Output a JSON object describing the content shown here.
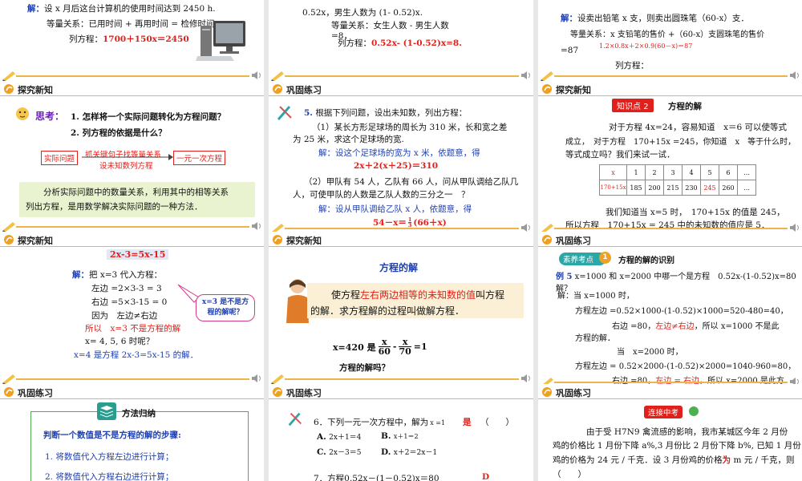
{
  "colors": {
    "header_accent": "#f0b24a",
    "title_red": "#e0201a",
    "answer_blue": "#1f3fae",
    "badge_red": "#e0201a",
    "badge_teal": "#2aa8a8",
    "panel_green": "#e9f3cf"
  },
  "icons": {
    "header": "orange-curl-icon",
    "footer_left": "pencil-icon",
    "footer_right": "speaker-icon",
    "computer": "desktop-computer-icon"
  },
  "s1": {
    "solve": "解：",
    "text1": "设 x 月后这台计算机的使用时间达到 2450 h.",
    "text2": "等量关系：已用时间 + 再用时间 = 检修时间,",
    "eq_label": "列方程：",
    "eq": "1700＋150x＝2450"
  },
  "s2": {
    "text1": "0.52x，男生人数为 (1- 0.52)x.",
    "text2": "等量关系：女生人数 - 男生人数",
    "text3": "=8，",
    "eq_label": "列方程：",
    "eq": "0.52x- (1-0.52)x=8."
  },
  "s3": {
    "solve": "解：",
    "text1": "设卖出铅笔 x 支，则卖出圆珠笔（60-x）支．",
    "text2": "等量关系：x 支铅笔的售价 +（60-x）支圆珠笔的售价",
    "text3": "=87",
    "eq": "1.2×0.8x＋2×0.9(60－x)＝87",
    "eq_label": "列方程："
  },
  "s4": {
    "title": "探究新知",
    "think": "思考：",
    "q1": "1. 怎样将一个实际问题转化为方程问题？",
    "q2": "2. 列方程的依据是什么？",
    "box1": "实际问题",
    "arrow_top": "抓关键句子找等量关系",
    "arrow_bottom": "设未知数列方程",
    "box2": "一元一次方程",
    "panel1": "分析实际问题中的数量关系，利用其中的相等关系",
    "panel2": "列出方程，是用数学解决实际问题的一种方法．"
  },
  "s5": {
    "title": "巩固练习",
    "num": "5.",
    "q": "根据下列问题，设出未知数，列出方程：",
    "p1a": "（1）某长方形足球场的周长为 310 米，长和宽之差",
    "p1b": "为 25 米，求这个足球场的宽.",
    "a1": "解：设这个足球场的宽为 x 米，依题意，得",
    "a1eq": "2x＋2(x＋25)＝310",
    "p2a": "（2）甲队有 54 人，乙队有 66 人，问从甲队调给乙队几",
    "p2b": "人，可使甲队的人数是乙队人数的三分之一　？",
    "a2": "解：设从甲队调给乙队 x 人，依题意，得",
    "a2eq_l": "54－x＝",
    "a2eq_num": "1",
    "a2eq_den": "3",
    "a2eq_r": "(66＋x)"
  },
  "s6": {
    "title": "探究新知",
    "badge_label": "知识点",
    "badge_num": "2",
    "badge_title": "方程的解",
    "t1": "对于方程 4x=24，容易知道　x＝6 可以使等式",
    "t2": "成立，　对于方程　170+15x =245，你知道　x　等于什么时，",
    "t3": "等式成立吗？我们来试一试．",
    "table_head": [
      "x",
      "1",
      "2",
      "3",
      "4",
      "5",
      "6",
      "…"
    ],
    "table_row": [
      "170+15x",
      "185",
      "200",
      "215",
      "230",
      "245",
      "260",
      "…"
    ],
    "b1": "我们知道当 x=5 时，　170+15x 的值是 245，",
    "b2": "所以方程　170+15x = 245 中的未知数的值应是 5．"
  },
  "s7": {
    "title": "探究新知",
    "eq": "2x-3=5x-15",
    "solve": "解：",
    "l1": "把 x=3 代入方程：",
    "l2": "左边 =2×3-3 = 3",
    "l3": "右边 =5×3-15 = 0",
    "l4": "因为　左边≠右边",
    "l5": "所以　x=3 不是方程的解",
    "l6": "x= 4, 5, 6 时呢？",
    "l7": "x=4 是方程 2x-3=5x-15 的解．",
    "callout": "x=3 是不是方程的解呢？"
  },
  "s8": {
    "title": "探究新知",
    "heading": "方程的解",
    "p1_a": "使方程",
    "p1_red": "左右两边相等的未知数的值",
    "p1_b": "叫方程",
    "p2": "的解．求方程解的过程叫做解方程．",
    "eq_l": "x=420 是",
    "f1_num": "x",
    "f1_den": "60",
    "minus": "-",
    "f2_num": "x",
    "f2_den": "70",
    "eq_r": "=1",
    "question": "方程的解吗？"
  },
  "s9": {
    "title": "巩固练习",
    "badge_label": "素养考点",
    "badge_num": "1",
    "badge_title": "方程的解的识别",
    "ex": "例 5",
    "q1": "x=1000 和 x=2000 中哪一个是方程　0.52x-(1-0.52)x=80　的",
    "q2": "解？",
    "a0": "解：当 x=1000 时，",
    "a1": "方程左边 =0.52×1000-(1-0.52)×1000=520-480=40，",
    "a2_a": "右边 =80，",
    "a2_red": "左边≠右边",
    "a2_b": "，所以 x=1000 不是此",
    "a3": "方程的解．",
    "a4": "当　x=2000 时，",
    "a5": "方程左边 = 0.52×2000-(1-0.52)×2000=1040-960=80，",
    "a6_a": "右边 =80，",
    "a6_red": "左边 = 右边",
    "a6_b": "，所以 x=2000 是此方"
  },
  "s10": {
    "title": "巩固练习",
    "badge": "方法归纳",
    "h": "判断一个数值是不是方程的解的步骤:",
    "step1": "1.  将数值代入方程左边进行计算；",
    "step2": "2.  将数值代入方程右边进行计算；"
  },
  "s11": {
    "title": "巩固练习",
    "q6_a": "6．下列一元一次方程中，解为",
    "q6_x": "x =1",
    "q6_b": "的是（　　）",
    "q6_is": "是",
    "oA_l": "A.",
    "oA": "2x＋1＝4",
    "oB_l": "B.",
    "oB": "x＋1＝2",
    "oC_l": "C.",
    "oC": "2x－3＝5",
    "oD_l": "D.",
    "oD": "x＋2＝2x－1",
    "q7": "7．方程0.52x－(1－0.52)x＝80",
    "q7_ans": "D"
  },
  "s12": {
    "title": "巩固练习",
    "badge": "连接中考",
    "t1": "由于受 H7N9 禽流感的影响，我市某城区今年 2 月份",
    "t2": "鸡的价格比 1 月份下降 a%,3 月份比 2 月份下降 b%, 已知 1 月份",
    "t3": "鸡的价格为 24 元 / 千克．设 3 月份鸡的价格",
    "t3_m": "为",
    "t3_b": " m 元 / 千克，则",
    "t4": "（　　）"
  }
}
